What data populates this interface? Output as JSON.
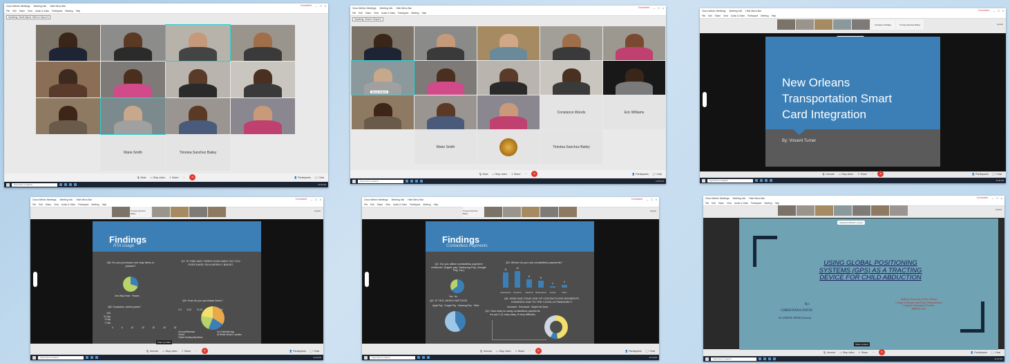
{
  "common": {
    "window_tabs": [
      "Cisco Webex Meetings",
      "Meeting Info",
      "Hide Menu Bar"
    ],
    "menu": [
      "File",
      "Edit",
      "Share",
      "View",
      "Audio & Video",
      "Participant",
      "Meeting",
      "Help"
    ],
    "connected": "Connected",
    "controls": {
      "mute": "Mute",
      "unmute": "Unmute",
      "stop_video": "Stop video",
      "share": "Share",
      "participants": "Participants",
      "chat": "Chat"
    },
    "taskbar_search": "Type here to search",
    "viewing": "Viewing the Brown's screen",
    "layout": "Layout",
    "colors": {
      "accent": "#3b7fb6",
      "end": "#e0372c",
      "selection": "#2bd1d1"
    }
  },
  "shot1": {
    "speaking": "Speaking: David Allport; Simeon Okporch",
    "names": {
      "tile_label_a": "David Allport",
      "tile_label_b": "Simeon Okporch"
    },
    "name_tiles": [
      "Marie Smith",
      "Timotea Sanchez Bailey"
    ],
    "clock": "10:49 AM"
  },
  "shot2": {
    "speaking": "Speaking: Simeon Okporch",
    "tile_label": "Simeon Okporch",
    "name_tiles": [
      "Constance Woods",
      "Eric Williams",
      "Marie Smith",
      "Timotea Sanchez Bailey"
    ],
    "clock": "10:58 AM"
  },
  "shot3": {
    "strip_names": [
      "Constance Wolfgan",
      "Timotea Sanchez Bailey"
    ],
    "slide_title_lines": [
      "New Orleans",
      "Transportation Smart",
      "Card Integration"
    ],
    "slide_by": "By: Vincent Turner",
    "clock": "11:06 AM"
  },
  "shot4": {
    "strip_names": [
      "Timotea Sanchez Bailey"
    ],
    "slide_title": "Findings",
    "slide_subtitle": "RTA Usage",
    "q6": "Q6: Do you purchase one way fares or passes?",
    "q6_legend": [
      "One Way Fares",
      "Passes"
    ],
    "q7": "Q7: IF ONE-WAY FARES HOW MANY DO YOU PURCHASE ON A WEEKLY BASIS?",
    "q7_categories": [
      "1-5",
      "6-10",
      "11-15",
      "16-20",
      "N/A"
    ],
    "q8": "Q8: If passes, which pass?",
    "q8_rows": [
      "N/A",
      "31 Day",
      "3 Day",
      "1 Day"
    ],
    "q8_ticks": [
      "0",
      "5",
      "10",
      "15",
      "20",
      "25",
      "30"
    ],
    "q9": "Q9: How do you purchase fares?",
    "q9_legend": [
      "On-bus/Streetcar",
      "Online",
      "Ticket Vending Machines",
      "On GoMobile App",
      "At Retail Vendor Location"
    ],
    "tooltip": "Stop my video",
    "clock": "11:10 AM"
  },
  "shot5": {
    "strip_names": [
      "Timotea Sanchez Bailey"
    ],
    "slide_title": "Findings",
    "slide_subtitle": "Contactless Payments",
    "q1": "Q1: Do you utilize contactless payment methods? (Apple pay, Samsung Pay, Google Pay, etc.)",
    "q1_legend": [
      "Yes",
      "No"
    ],
    "q2": "Q2: IF YES, WHICH METHOD",
    "q2_legend": [
      "Apple Pay",
      "Google Pay",
      "Samsung Pay",
      "Other"
    ],
    "q3": "Q3: Where do you use contactless payments?",
    "q3_categories": [
      "Restaurants",
      "Groceries",
      "Gas/Fuel",
      "Retail Stores",
      "Transit",
      "Other"
    ],
    "q3_values": [
      11,
      12,
      6,
      5,
      1,
      2
    ],
    "q4": "Q4: How easy is using contactless payments for you? (1-very easy, 5-very difficult)",
    "q5": "Q5: HOW HAS YOUR USE OF CONTACTLESS PAYMENTS CHANGED DUE TO THE COVID-19 PANDEMIC?",
    "q5_legend": [
      "Increased",
      "Decreased",
      "Stayed the Same"
    ],
    "clock": "11:13 AM"
  },
  "shot6": {
    "slide_title_lines": [
      "USING GLOBAL POSITIONING",
      "SYSTEMS (GPS) AS A TRACTING",
      "DEVICE  FOR  CHILD ABDUCTION"
    ],
    "by": "By:",
    "author": "CHRISTIANA DAVIS",
    "advisor": "Dr. SAMUEL SWENI (Advisor)",
    "institution_lines": [
      "Southern University at New Orleans",
      "College of Business and Public Administration",
      "Computer Information Systems",
      "SPRING 2021"
    ],
    "tooltip": "Share content",
    "clock": "11:22 AM"
  }
}
